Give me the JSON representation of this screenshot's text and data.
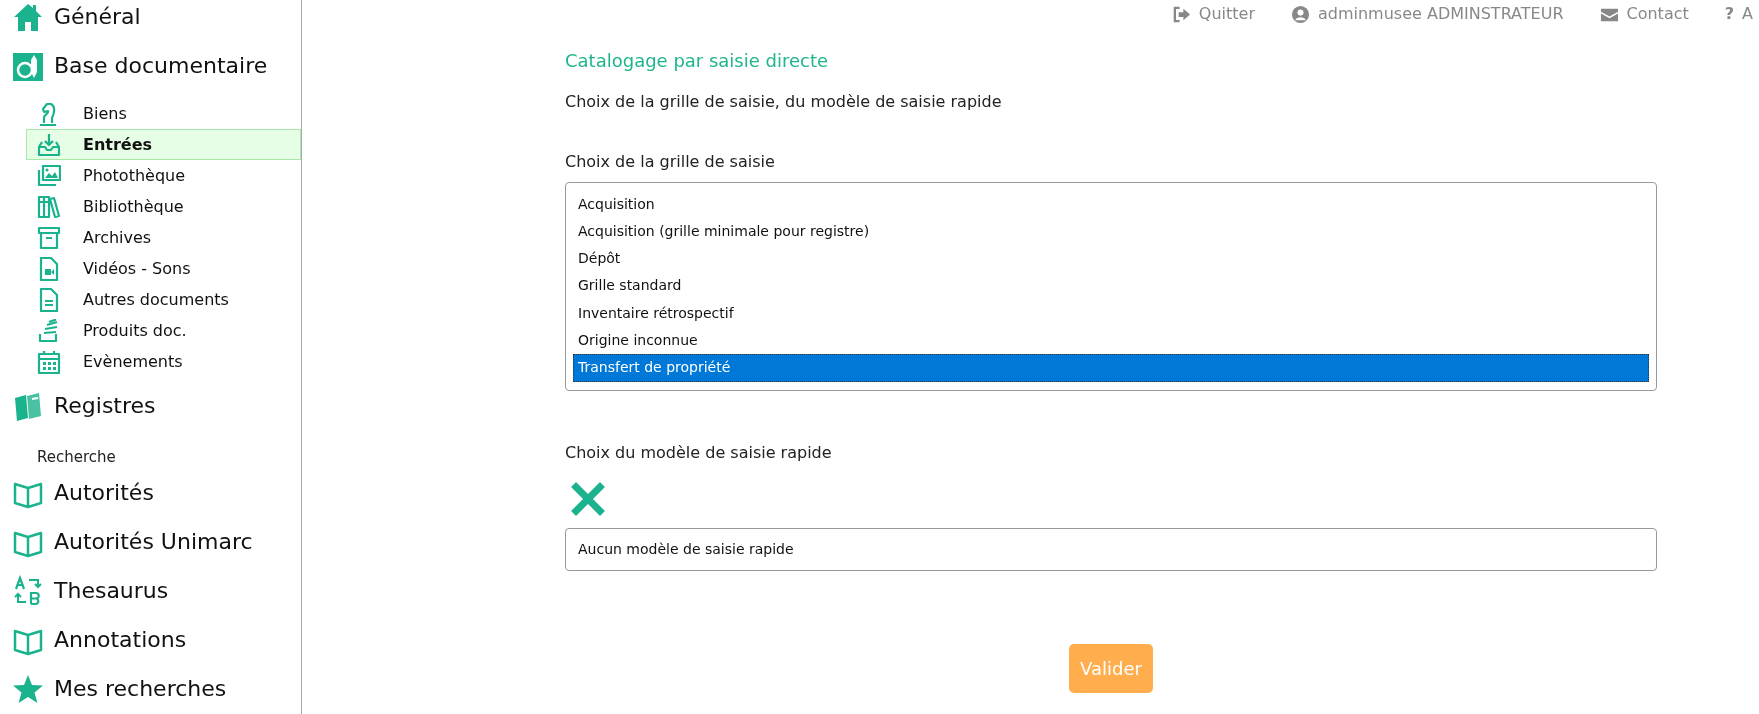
{
  "top_links": [
    {
      "label": "Quitter"
    },
    {
      "label": "adminmusee ADMINSTRATEUR"
    },
    {
      "label": "Contact"
    },
    {
      "label": "A",
      "icon_text": "?"
    }
  ],
  "sidebar": {
    "items": [
      {
        "kind": "main",
        "label": "Général"
      },
      {
        "kind": "main",
        "label": "Base documentaire",
        "children": [
          {
            "label": "Biens",
            "selected": false
          },
          {
            "label": "Entrées",
            "selected": true
          },
          {
            "label": "Photothèque",
            "selected": false
          },
          {
            "label": "Bibliothèque",
            "selected": false
          },
          {
            "label": "Archives",
            "selected": false
          },
          {
            "label": "Vidéos - Sons",
            "selected": false
          },
          {
            "label": "Autres documents",
            "selected": false
          },
          {
            "label": "Produits doc.",
            "selected": false
          },
          {
            "label": "Evènements",
            "selected": false
          }
        ]
      },
      {
        "kind": "main",
        "label": "Registres"
      },
      {
        "kind": "heading",
        "label": "Recherche"
      },
      {
        "kind": "main",
        "label": "Autorités"
      },
      {
        "kind": "main",
        "label": "Autorités Unimarc"
      },
      {
        "kind": "main",
        "label": "Thesaurus"
      },
      {
        "kind": "main",
        "label": "Annotations"
      },
      {
        "kind": "main",
        "label": "Mes recherches"
      }
    ]
  },
  "main": {
    "title": "Catalogage par saisie directe",
    "subtitle": "Choix de la grille de saisie, du modèle de saisie rapide",
    "grid_label": "Choix de la grille de saisie",
    "grid_options": [
      {
        "label": "Acquisition",
        "selected": false
      },
      {
        "label": "Acquisition (grille minimale pour registre)",
        "selected": false
      },
      {
        "label": "Dépôt",
        "selected": false
      },
      {
        "label": "Grille standard",
        "selected": false
      },
      {
        "label": "Inventaire rétrospectif",
        "selected": false
      },
      {
        "label": "Origine inconnue",
        "selected": false
      },
      {
        "label": "Transfert de propriété",
        "selected": true
      }
    ],
    "model_label": "Choix du modèle de saisie rapide",
    "model_field": {
      "value": "Aucun modèle de saisie rapide"
    },
    "submit": "Valider"
  }
}
